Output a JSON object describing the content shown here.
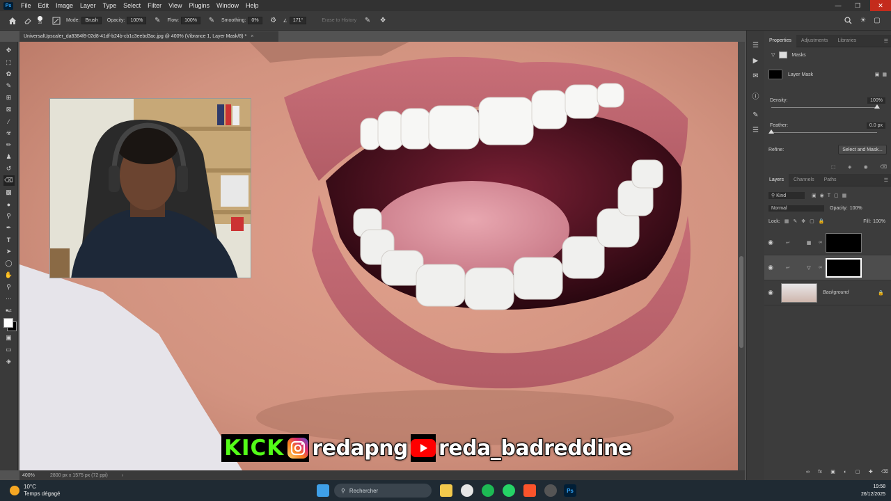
{
  "app": {
    "logo_text": "Ps"
  },
  "menu": [
    "File",
    "Edit",
    "Image",
    "Layer",
    "Type",
    "Select",
    "Filter",
    "View",
    "Plugins",
    "Window",
    "Help"
  ],
  "options": {
    "brush_size": "35",
    "mode_label": "Mode:",
    "mode_value": "Brush",
    "opacity_label": "Opacity:",
    "opacity_value": "100%",
    "flow_label": "Flow:",
    "flow_value": "100%",
    "smoothing_label": "Smoothing:",
    "smoothing_value": "0%",
    "angle_value": "171°",
    "erase_to_history": "Erase to History"
  },
  "document": {
    "tab_title": "UniversalUpscaler_da8384f8-02d8-41df-b24b-cb1c3eebd3ac.jpg @ 400% (Vibrance 1, Layer Mask/8) *",
    "tab_close": "×",
    "zoom": "400%",
    "dimensions": "2800 px x 1575 px (72 ppi)"
  },
  "properties": {
    "tabs": [
      "Properties",
      "Adjustments",
      "Libraries"
    ],
    "section_label": "Masks",
    "layer_mask_label": "Layer Mask",
    "density_label": "Density:",
    "density_value": "100%",
    "density_level": 1.0,
    "feather_label": "Feather:",
    "feather_value": "0.0 px",
    "feather_level": 0.0,
    "refine_label": "Refine:",
    "select_mask_button": "Select and Mask..."
  },
  "layers": {
    "tabs": [
      "Layers",
      "Channels",
      "Paths"
    ],
    "filter_kind": "Kind",
    "blend_mode": "Normal",
    "opacity_label": "Opacity:",
    "opacity_value": "100%",
    "lock_label": "Lock:",
    "fill_label": "Fill:",
    "fill_value": "100%",
    "items": [
      {
        "name": "",
        "type": "curves-adjustment",
        "visible": true,
        "selected": false
      },
      {
        "name": "",
        "type": "vibrance-adjustment",
        "visible": true,
        "selected": true
      },
      {
        "name": "Background",
        "type": "image",
        "visible": true,
        "selected": false,
        "locked": true
      }
    ]
  },
  "overlay": {
    "kick_text": "KICK",
    "instagram_handle": "redapng",
    "youtube_handle": "reda_badreddine"
  },
  "taskbar": {
    "temperature": "10°C",
    "weather": "Temps dégagé",
    "search_placeholder": "Rechercher",
    "time": "19:58",
    "date": "26/12/2025"
  }
}
